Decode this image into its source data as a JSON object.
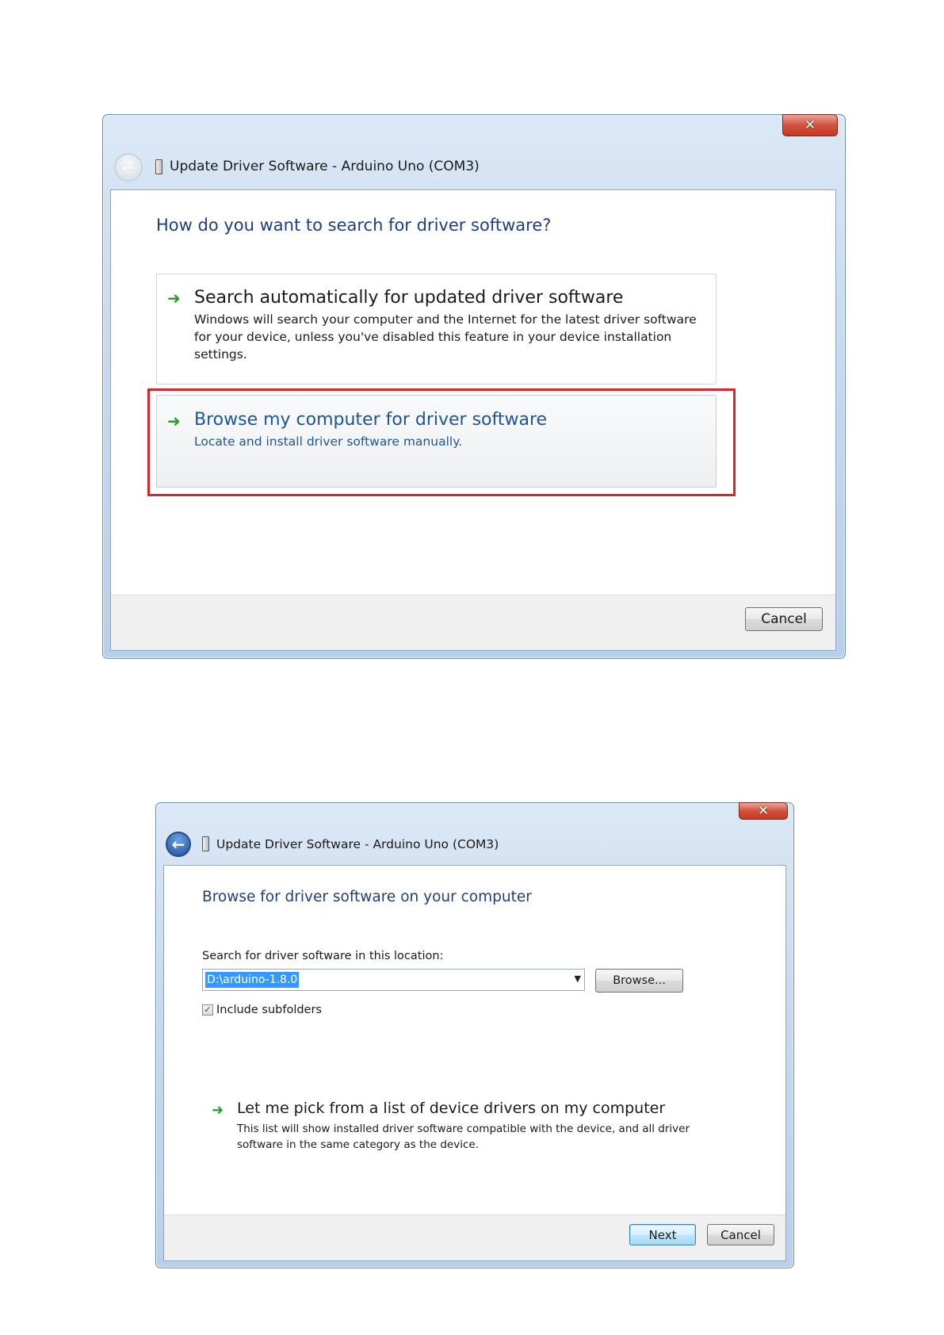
{
  "dialog1": {
    "title": "Update Driver Software - Arduino Uno (COM3)",
    "close_glyph": "✕",
    "back_glyph": "←",
    "heading": "How do you want to search for driver software?",
    "option_auto": {
      "title": "Search automatically for updated driver software",
      "description": "Windows will search your computer and the Internet for the latest driver software for your device, unless you've disabled this feature in your device installation settings."
    },
    "option_browse": {
      "title": "Browse my computer for driver software",
      "description": "Locate and install driver software manually."
    },
    "arrow_glyph": "➜",
    "cancel_label": "Cancel",
    "highlight_color": "#d8262e"
  },
  "dialog2": {
    "title": "Update Driver Software - Arduino Uno (COM3)",
    "close_glyph": "✕",
    "back_glyph": "←",
    "heading": "Browse for driver software on your computer",
    "location_label": "Search for driver software in this location:",
    "location_value": "D:\\arduino-1.8.0",
    "dropdown_glyph": "▼",
    "browse_label": "Browse...",
    "include_subfolders_label": "Include subfolders",
    "include_subfolders_checked": true,
    "check_glyph": "✓",
    "pick_option": {
      "title": "Let me pick from a list of device drivers on my computer",
      "description": "This list will show installed driver software compatible with the device, and all driver software in the same category as the device."
    },
    "arrow_glyph": "➜",
    "next_label": "Next",
    "cancel_label": "Cancel"
  }
}
